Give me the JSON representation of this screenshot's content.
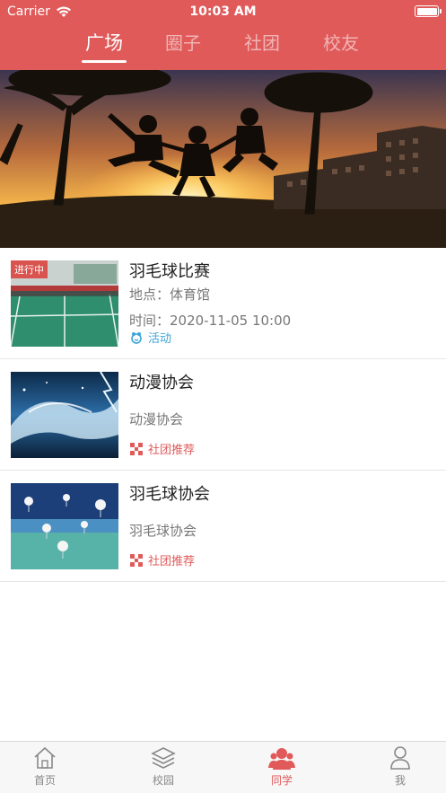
{
  "status_bar": {
    "carrier": "Carrier",
    "time": "10:03 AM"
  },
  "top_tabs": [
    {
      "label": "广场",
      "active": true
    },
    {
      "label": "圈子",
      "active": false
    },
    {
      "label": "社团",
      "active": false
    },
    {
      "label": "校友",
      "active": false
    }
  ],
  "items": [
    {
      "title": "羽毛球比赛",
      "badge": "进行中",
      "line1": "地点：体育馆",
      "line2": "时间：2020-11-05 10:00",
      "tag": "活动"
    },
    {
      "title": "动漫协会",
      "line1": "动漫协会",
      "tag": "社团推荐"
    },
    {
      "title": "羽毛球协会",
      "line1": "羽毛球协会",
      "tag": "社团推荐"
    }
  ],
  "bottom_nav": [
    {
      "label": "首页",
      "icon": "home-icon"
    },
    {
      "label": "校园",
      "icon": "layers-icon"
    },
    {
      "label": "同学",
      "icon": "classmates-icon",
      "active": true
    },
    {
      "label": "我",
      "icon": "profile-icon"
    }
  ],
  "colors": {
    "primary": "#e05a5a",
    "activity_tag": "#3aa6d8"
  }
}
